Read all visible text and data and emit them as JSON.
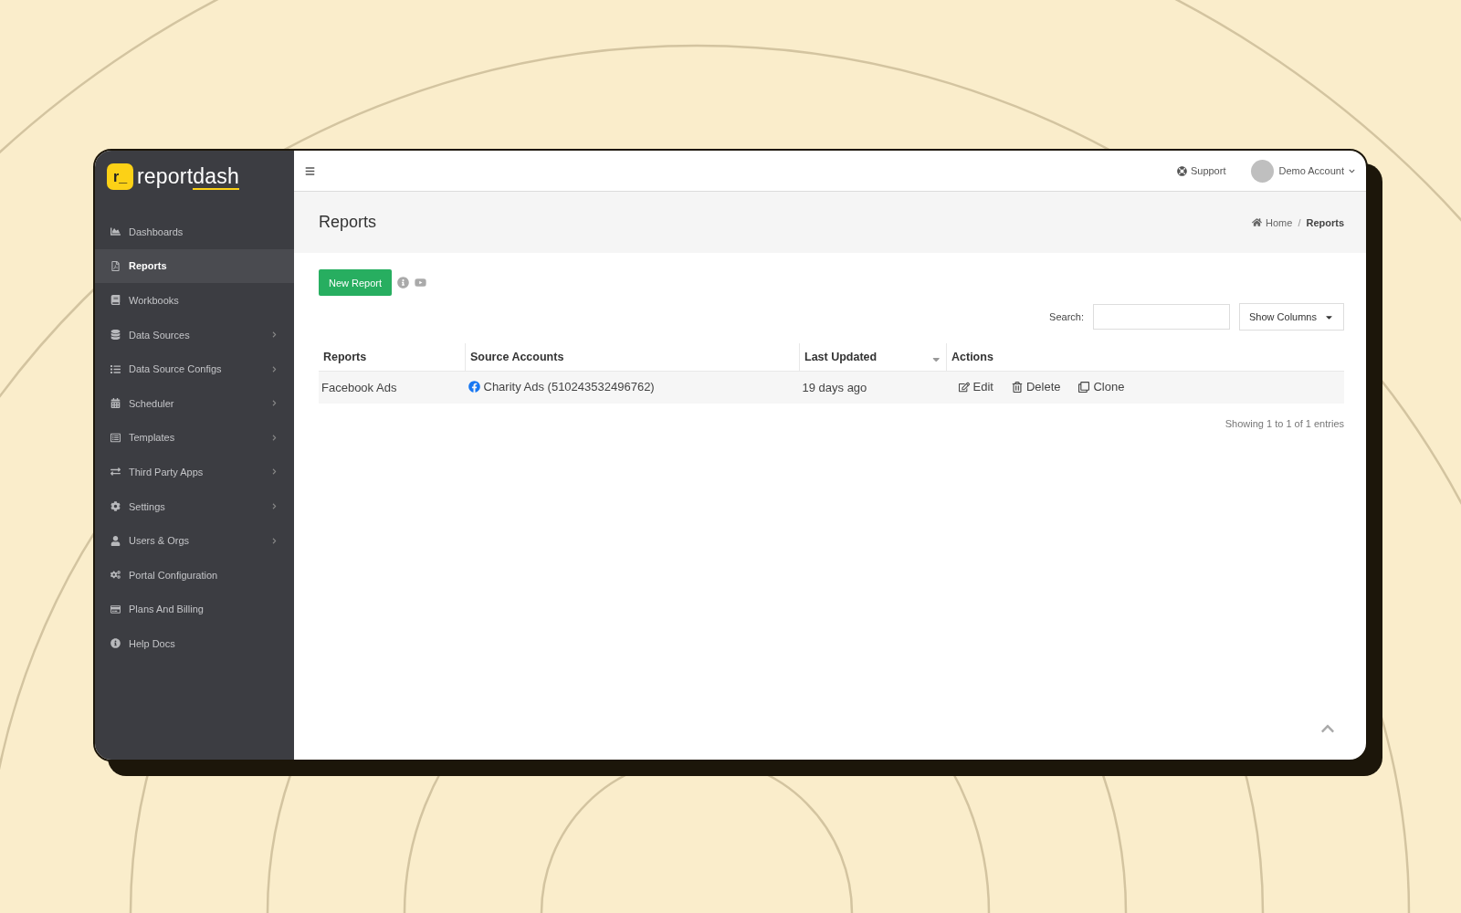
{
  "logo": {
    "text": "report",
    "accent": "dash",
    "mark": "r_"
  },
  "sidebar": {
    "items": [
      {
        "label": "Dashboards",
        "selected": false,
        "expandable": false
      },
      {
        "label": "Reports",
        "selected": true,
        "expandable": false
      },
      {
        "label": "Workbooks",
        "selected": false,
        "expandable": false
      },
      {
        "label": "Data Sources",
        "selected": false,
        "expandable": true
      },
      {
        "label": "Data Source Configs",
        "selected": false,
        "expandable": true
      },
      {
        "label": "Scheduler",
        "selected": false,
        "expandable": true
      },
      {
        "label": "Templates",
        "selected": false,
        "expandable": true
      },
      {
        "label": "Third Party Apps",
        "selected": false,
        "expandable": true
      },
      {
        "label": "Settings",
        "selected": false,
        "expandable": true
      },
      {
        "label": "Users & Orgs",
        "selected": false,
        "expandable": true
      },
      {
        "label": "Portal Configuration",
        "selected": false,
        "expandable": false
      },
      {
        "label": "Plans And Billing",
        "selected": false,
        "expandable": false
      },
      {
        "label": "Help Docs",
        "selected": false,
        "expandable": false
      }
    ]
  },
  "topbar": {
    "support": "Support",
    "account": "Demo Account"
  },
  "page": {
    "title": "Reports",
    "breadcrumb": [
      "Home",
      "Reports"
    ],
    "separator": "/"
  },
  "toolbar": {
    "new_button": "New Report",
    "search_label": "Search:",
    "columns_button": "Show Columns"
  },
  "table": {
    "columns": [
      "Reports",
      "Source Accounts",
      "Last Updated",
      "Actions"
    ],
    "rows": [
      {
        "report": "Facebook Ads",
        "account": "Charity Ads (510243532496762)",
        "updated": "19 days ago",
        "actions": [
          "Edit",
          "Delete",
          "Clone"
        ]
      }
    ]
  },
  "footer": {
    "info": "Showing 1 to 1 of 1 entries"
  }
}
